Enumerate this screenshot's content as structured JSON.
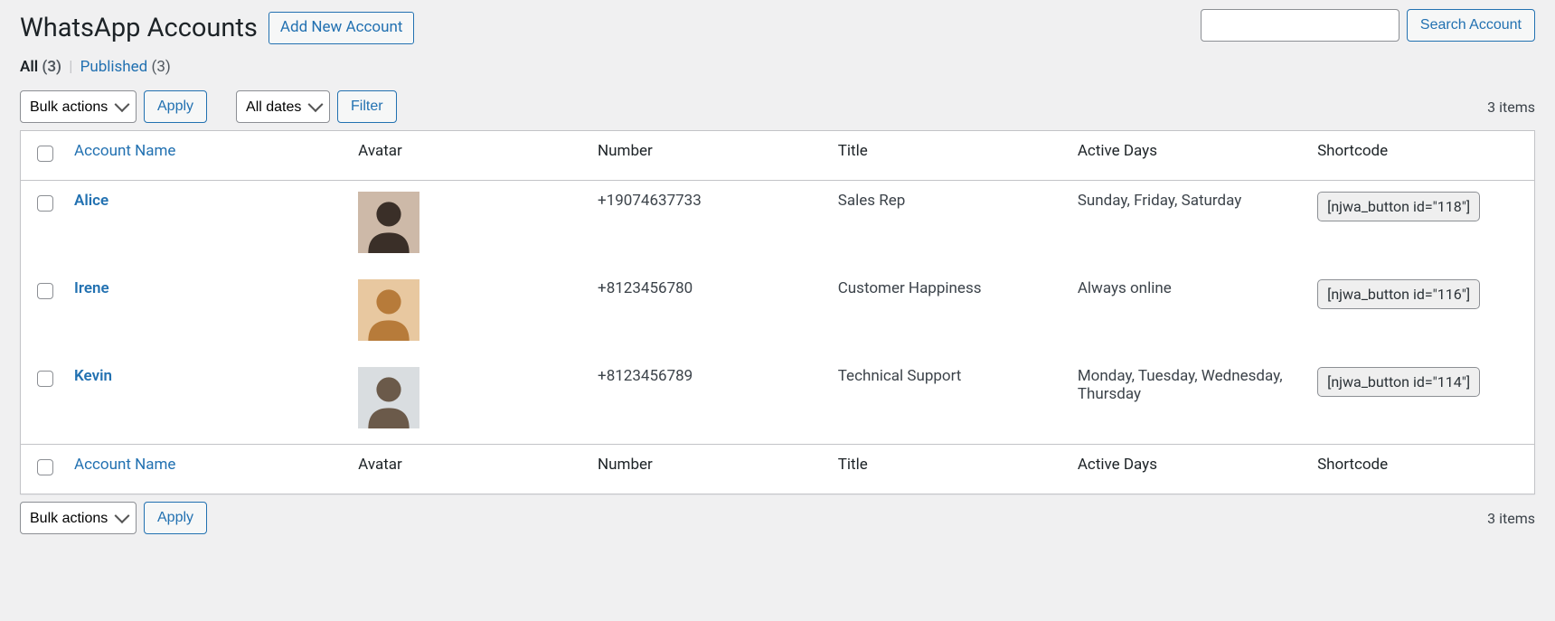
{
  "header": {
    "title": "WhatsApp Accounts",
    "add_new_label": "Add New Account"
  },
  "filters": {
    "all_label": "All",
    "all_count": "(3)",
    "published_label": "Published",
    "published_count": "(3)"
  },
  "search": {
    "button_label": "Search Account"
  },
  "bulk": {
    "placeholder": "Bulk actions",
    "apply_label": "Apply"
  },
  "date_filter": {
    "placeholder": "All dates",
    "filter_label": "Filter"
  },
  "pagination": {
    "items_label": "3 items"
  },
  "columns": {
    "name": "Account Name",
    "avatar": "Avatar",
    "number": "Number",
    "title": "Title",
    "days": "Active Days",
    "shortcode": "Shortcode"
  },
  "rows": [
    {
      "name": "Alice",
      "number": "+19074637733",
      "title": "Sales Rep",
      "days": "Sunday, Friday, Saturday",
      "shortcode": "[njwa_button id=\"118\"]",
      "avatar_bg": "#cdb9a8",
      "avatar_fg": "#3a2f28"
    },
    {
      "name": "Irene",
      "number": "+8123456780",
      "title": "Customer Happiness",
      "days": "Always online",
      "shortcode": "[njwa_button id=\"116\"]",
      "avatar_bg": "#e8c8a0",
      "avatar_fg": "#b77b3a"
    },
    {
      "name": "Kevin",
      "number": "+8123456789",
      "title": "Technical Support",
      "days": "Monday, Tuesday, Wednesday, Thursday",
      "shortcode": "[njwa_button id=\"114\"]",
      "avatar_bg": "#d9dde0",
      "avatar_fg": "#6b5a4a"
    }
  ]
}
